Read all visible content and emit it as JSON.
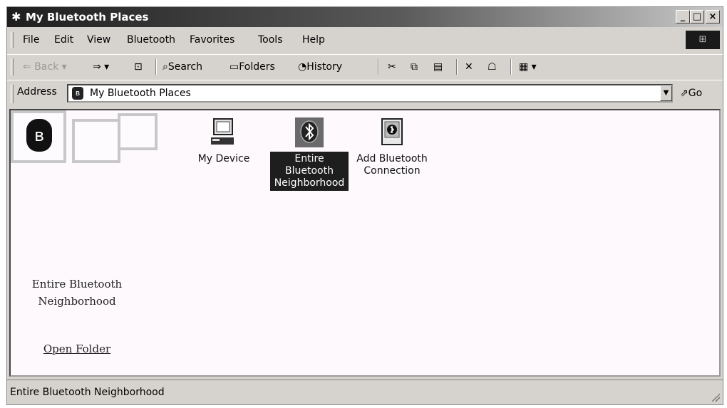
{
  "window": {
    "title": "My Bluetooth Places",
    "title_icon": "✱",
    "controls": [
      "_",
      "□",
      "×"
    ]
  },
  "menu": {
    "items": [
      "File",
      "Edit",
      "View",
      "Bluetooth",
      "Favorites",
      "Tools",
      "Help"
    ]
  },
  "toolbar": {
    "back": "Back",
    "search": "Search",
    "folders": "Folders",
    "history": "History"
  },
  "address": {
    "label": "Address",
    "value": "My Bluetooth Places",
    "go": "Go"
  },
  "sidebar": {
    "title": "Entire Bluetooth Neighborhood",
    "link": "Open Folder"
  },
  "items": [
    {
      "label": "My Device",
      "icon": "computer-icon",
      "selected": false
    },
    {
      "label": "Entire Bluetooth Neighborhood",
      "icon": "bluetooth-globe-icon",
      "selected": true
    },
    {
      "label": "Add Bluetooth Connection",
      "icon": "add-connection-icon",
      "selected": false
    }
  ],
  "status": {
    "text": "Entire Bluetooth Neighborhood"
  }
}
